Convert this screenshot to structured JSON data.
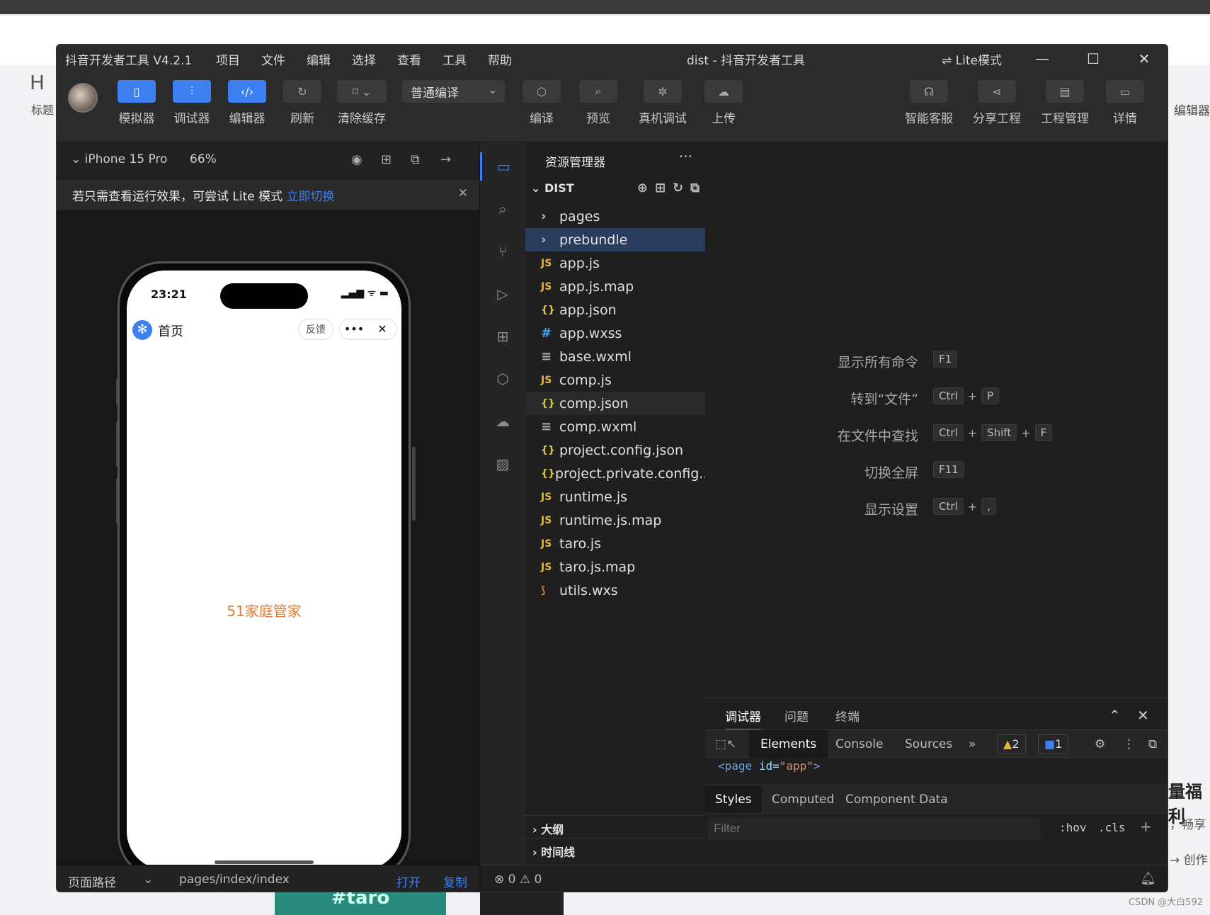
{
  "background": {
    "left_heading": "H",
    "left_label": "标题",
    "right_edit": "编辑器",
    "right_big": "量福利",
    "right_sub1": "，畅享",
    "right_sub2": "→ 创作",
    "bottom_tile": "#taro",
    "watermark": "CSDN @大白592"
  },
  "window": {
    "app_title": "抖音开发者工具 V4.2.1",
    "menu": [
      "项目",
      "文件",
      "编辑",
      "选择",
      "查看",
      "工具",
      "帮助"
    ],
    "center_title": "dist - 抖音开发者工具",
    "lite_mode": "⇌ Lite模式",
    "controls": {
      "minimize": "—",
      "maximize": "☐",
      "close": "✕"
    }
  },
  "toolbar": {
    "simulator": "模拟器",
    "debugger": "调试器",
    "editor": "编辑器",
    "refresh": "刷新",
    "clear_cache": "清除缓存",
    "compile_mode": "普通编译",
    "compile": "编译",
    "preview": "预览",
    "device_debug": "真机调试",
    "upload": "上传",
    "support": "智能客服",
    "share": "分享工程",
    "project_mgmt": "工程管理",
    "details": "详情"
  },
  "simulator": {
    "device": "iPhone 15 Pro",
    "zoom": "66%",
    "tip_text": "若只需查看运行效果，可尝试 Lite 模式 ",
    "tip_link": "立即切换",
    "status_time": "23:21",
    "nav_title": "首页",
    "feedback": "反馈",
    "page_text": "51家庭管家",
    "footer_label": "页面路径",
    "footer_path": "pages/index/index",
    "footer_open": "打开",
    "footer_copy": "复制"
  },
  "explorer": {
    "title": "资源管理器",
    "root": "DIST",
    "items": [
      {
        "name": "pages",
        "type": "folder"
      },
      {
        "name": "prebundle",
        "type": "folder"
      },
      {
        "name": "app.js",
        "type": "js"
      },
      {
        "name": "app.js.map",
        "type": "js"
      },
      {
        "name": "app.json",
        "type": "json"
      },
      {
        "name": "app.wxss",
        "type": "css"
      },
      {
        "name": "base.wxml",
        "type": "xml"
      },
      {
        "name": "comp.js",
        "type": "js"
      },
      {
        "name": "comp.json",
        "type": "json"
      },
      {
        "name": "comp.wxml",
        "type": "xml"
      },
      {
        "name": "project.config.json",
        "type": "json"
      },
      {
        "name": "project.private.config....",
        "type": "json"
      },
      {
        "name": "runtime.js",
        "type": "js"
      },
      {
        "name": "runtime.js.map",
        "type": "js"
      },
      {
        "name": "taro.js",
        "type": "js"
      },
      {
        "name": "taro.js.map",
        "type": "js"
      },
      {
        "name": "utils.wxs",
        "type": "wxs"
      }
    ],
    "outline": "大纲",
    "timeline": "时间线"
  },
  "shortcuts": [
    {
      "label": "显示所有命令",
      "keys": [
        "F1"
      ]
    },
    {
      "label": "转到“文件”",
      "keys": [
        "Ctrl",
        "P"
      ]
    },
    {
      "label": "在文件中查找",
      "keys": [
        "Ctrl",
        "Shift",
        "F"
      ]
    },
    {
      "label": "切换全屏",
      "keys": [
        "F11"
      ]
    },
    {
      "label": "显示设置",
      "keys": [
        "Ctrl",
        ","
      ]
    }
  ],
  "debug_panel": {
    "tabs": [
      "调试器",
      "问题",
      "终端"
    ],
    "devtools_tabs": [
      "Elements",
      "Console",
      "Sources"
    ],
    "warnings": "2",
    "messages": "1",
    "code_tag_open": "<page",
    "code_attr": "id=",
    "code_val": "\"app\"",
    "code_tag_close": ">",
    "styles_tabs": [
      "Styles",
      "Computed",
      "Component Data"
    ],
    "filter_placeholder": "Filter",
    "hov": ":hov",
    "cls": ".cls"
  },
  "statusbar": {
    "errors": "0",
    "warnings": "0"
  }
}
